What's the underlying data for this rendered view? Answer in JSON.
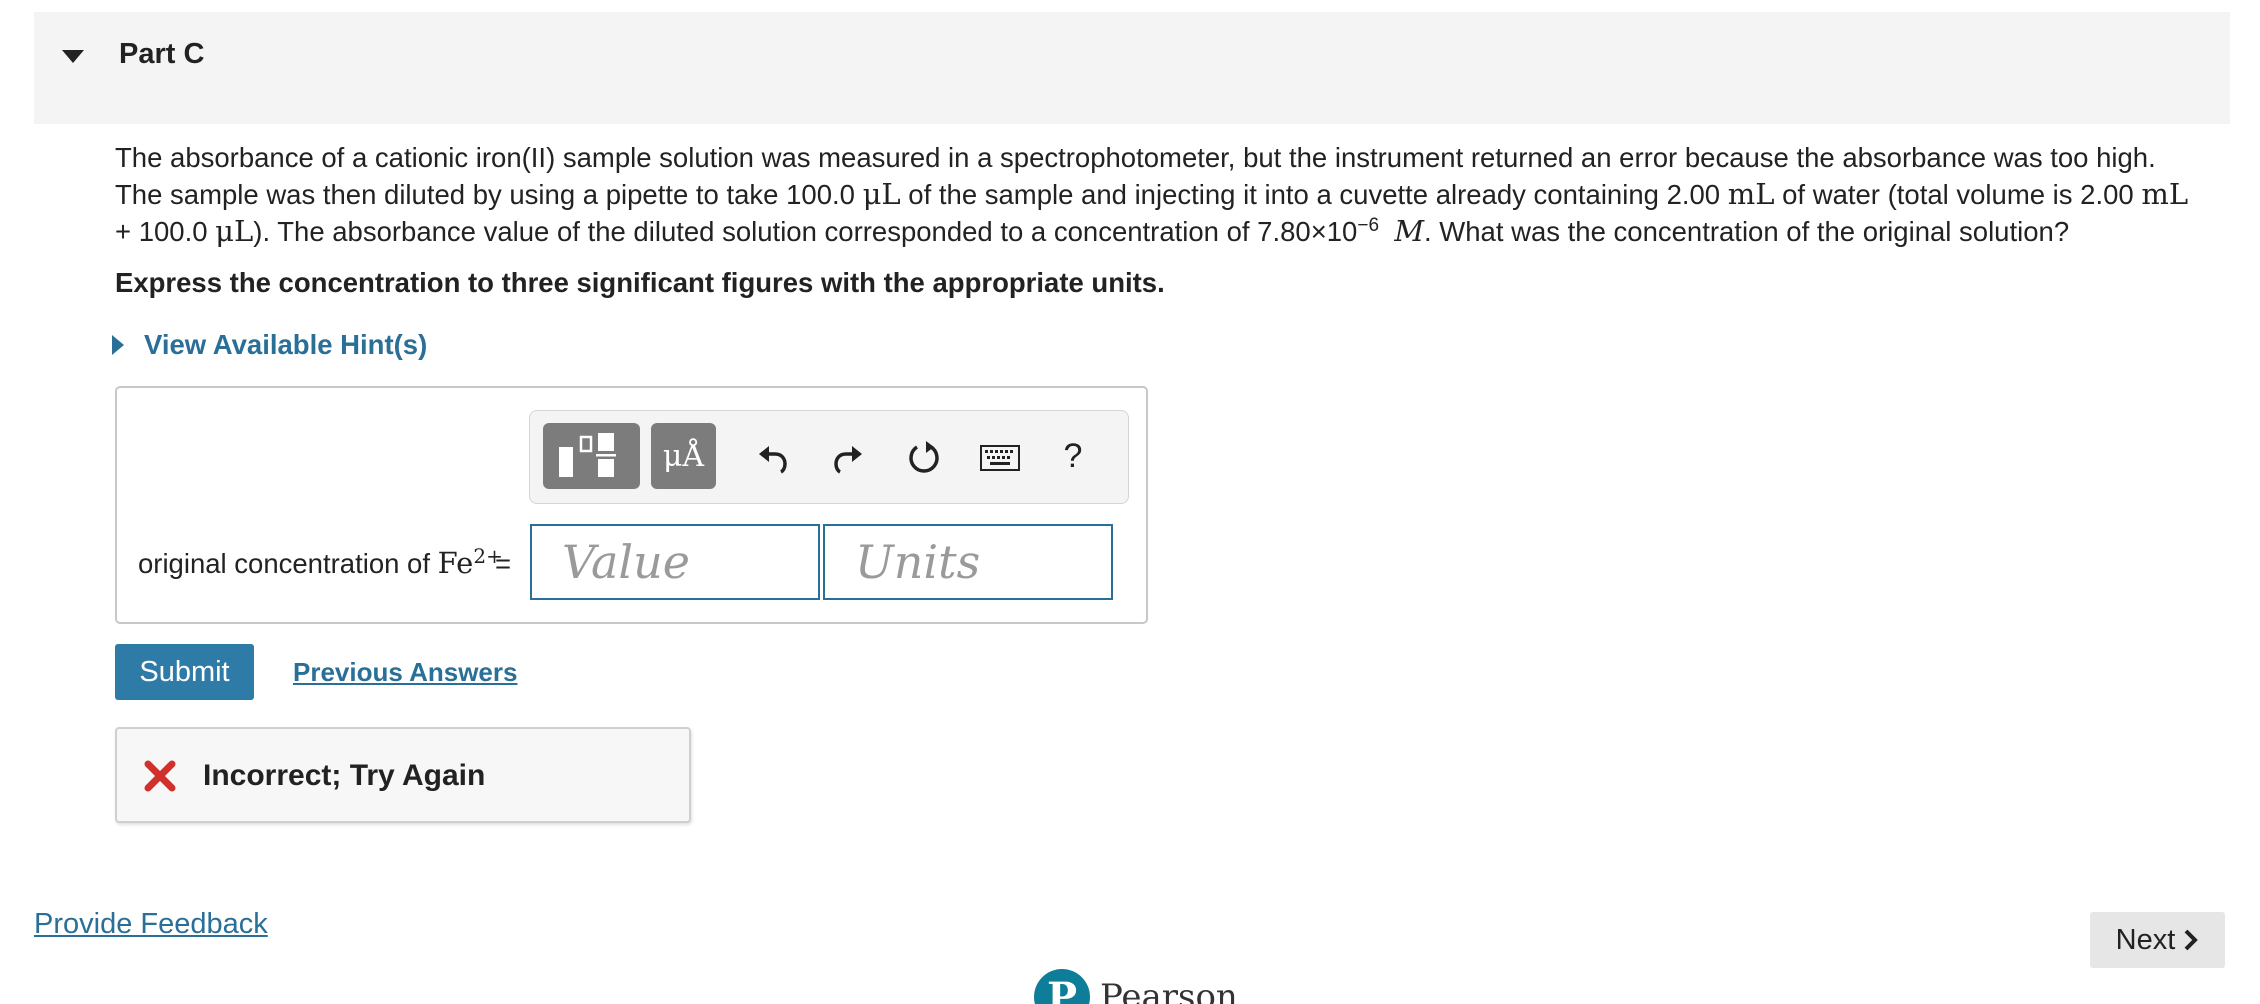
{
  "part": {
    "title": "Part C"
  },
  "question": {
    "t1": "The absorbance of a cationic iron(II) sample solution was measured in a spectrophotometer, but the instrument returned an error because the absorbance was too high. The sample was then diluted by using a pipette to take 100.0 ",
    "u1": "μL",
    "t2": " of the sample and injecting it into a cuvette already containing 2.00 ",
    "u2": "mL",
    "t3": " of water (total volume is 2.00 ",
    "u3": "mL",
    "t4": " + 100.0 ",
    "u4": "μL",
    "t5": "). The absorbance value of the diluted solution corresponded to a concentration of 7.80×10",
    "exp": "−6",
    "unit_m": "M",
    "t6": ". What was the concentration of the original solution?"
  },
  "instruction": "Express the concentration to three significant figures with the appropriate units.",
  "hint": {
    "label": "View Available Hint(s)"
  },
  "toolbar": {
    "template_icon": "template-icon",
    "units_label": "μÅ",
    "undo_icon": "undo-icon",
    "redo_icon": "redo-icon",
    "reset_icon": "reset-icon",
    "keyboard_icon": "keyboard-icon",
    "help_label": "?"
  },
  "answer": {
    "label_prefix": "original concentration of ",
    "species": "Fe",
    "charge": "2+",
    "equals": "=",
    "value_placeholder": "Value",
    "value": "",
    "units_placeholder": "Units",
    "units": ""
  },
  "actions": {
    "submit": "Submit",
    "previous_answers": "Previous Answers"
  },
  "feedback": {
    "icon": "x-icon",
    "color": "#d0312d",
    "text": "Incorrect; Try Again"
  },
  "footer": {
    "provide_feedback": "Provide Feedback",
    "next": "Next",
    "brand": "Pearson"
  },
  "colors": {
    "accent": "#2f7ba7",
    "link": "#2a6f97",
    "header_bg": "#f4f4f4"
  }
}
